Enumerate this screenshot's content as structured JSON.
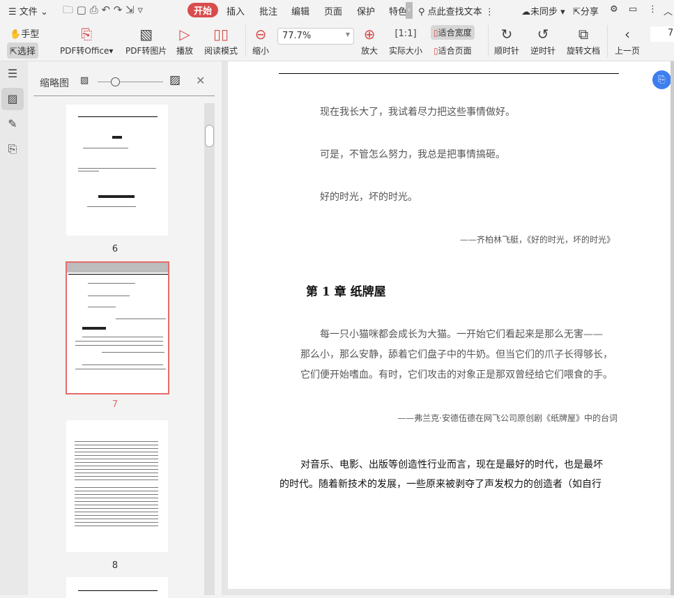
{
  "menu": {
    "file": "文件",
    "tabs": [
      "开始",
      "插入",
      "批注",
      "编辑",
      "页面",
      "保护",
      "特色"
    ],
    "search": "点此查找文本",
    "sync": "未同步",
    "share": "分享"
  },
  "toolbar": {
    "hand": "手型",
    "select": "选择",
    "pdf_to_office": "PDF转Office",
    "pdf_to_image": "PDF转图片",
    "play": "播放",
    "read_mode": "阅读模式",
    "zoom_out": "缩小",
    "zoom_value": "77.7%",
    "zoom_in": "放大",
    "actual_size": "实际大小",
    "fit_width": "适合宽度",
    "fit_page": "适合页面",
    "rotate_cw": "顺时针",
    "rotate_ccw": "逆时针",
    "rotate_doc": "旋转文档",
    "prev_page": "上一页",
    "page_input": "7"
  },
  "panel": {
    "title": "缩略图",
    "pages": [
      "6",
      "7",
      "8"
    ],
    "selected": "7"
  },
  "document": {
    "epigraph": [
      "现在我长大了，我试着尽力把这些事情做好。",
      "可是，不管怎么努力，我总是把事情搞砸。",
      "好的时光，坏的时光。"
    ],
    "epigraph_source": "——齐柏林飞艇，《好的时光，坏的时光》",
    "chapter_title": "第 1 章 纸牌屋",
    "quote": [
      "每一只小猫咪都会成长为大猫。一开始它们看起来是那么无害——",
      "那么小，那么安静，舔着它们盘子中的牛奶。但当它们的爪子长得够长，",
      "它们便开始嗜血。有时，它们攻击的对象正是那双曾经给它们喂食的手。"
    ],
    "quote_source": "——弗兰克·安德伍德在网飞公司原创剧《纸牌屋》中的台词",
    "body": [
      "对音乐、电影、出版等创造性行业而言，现在是最好的时代，也是最坏",
      "的时代。随着新技术的发展，一些原来被剥夺了声发权力的创造者（如自行"
    ]
  },
  "colors": {
    "accent": "#d94c4c",
    "float_button": "#3d7ef0"
  }
}
